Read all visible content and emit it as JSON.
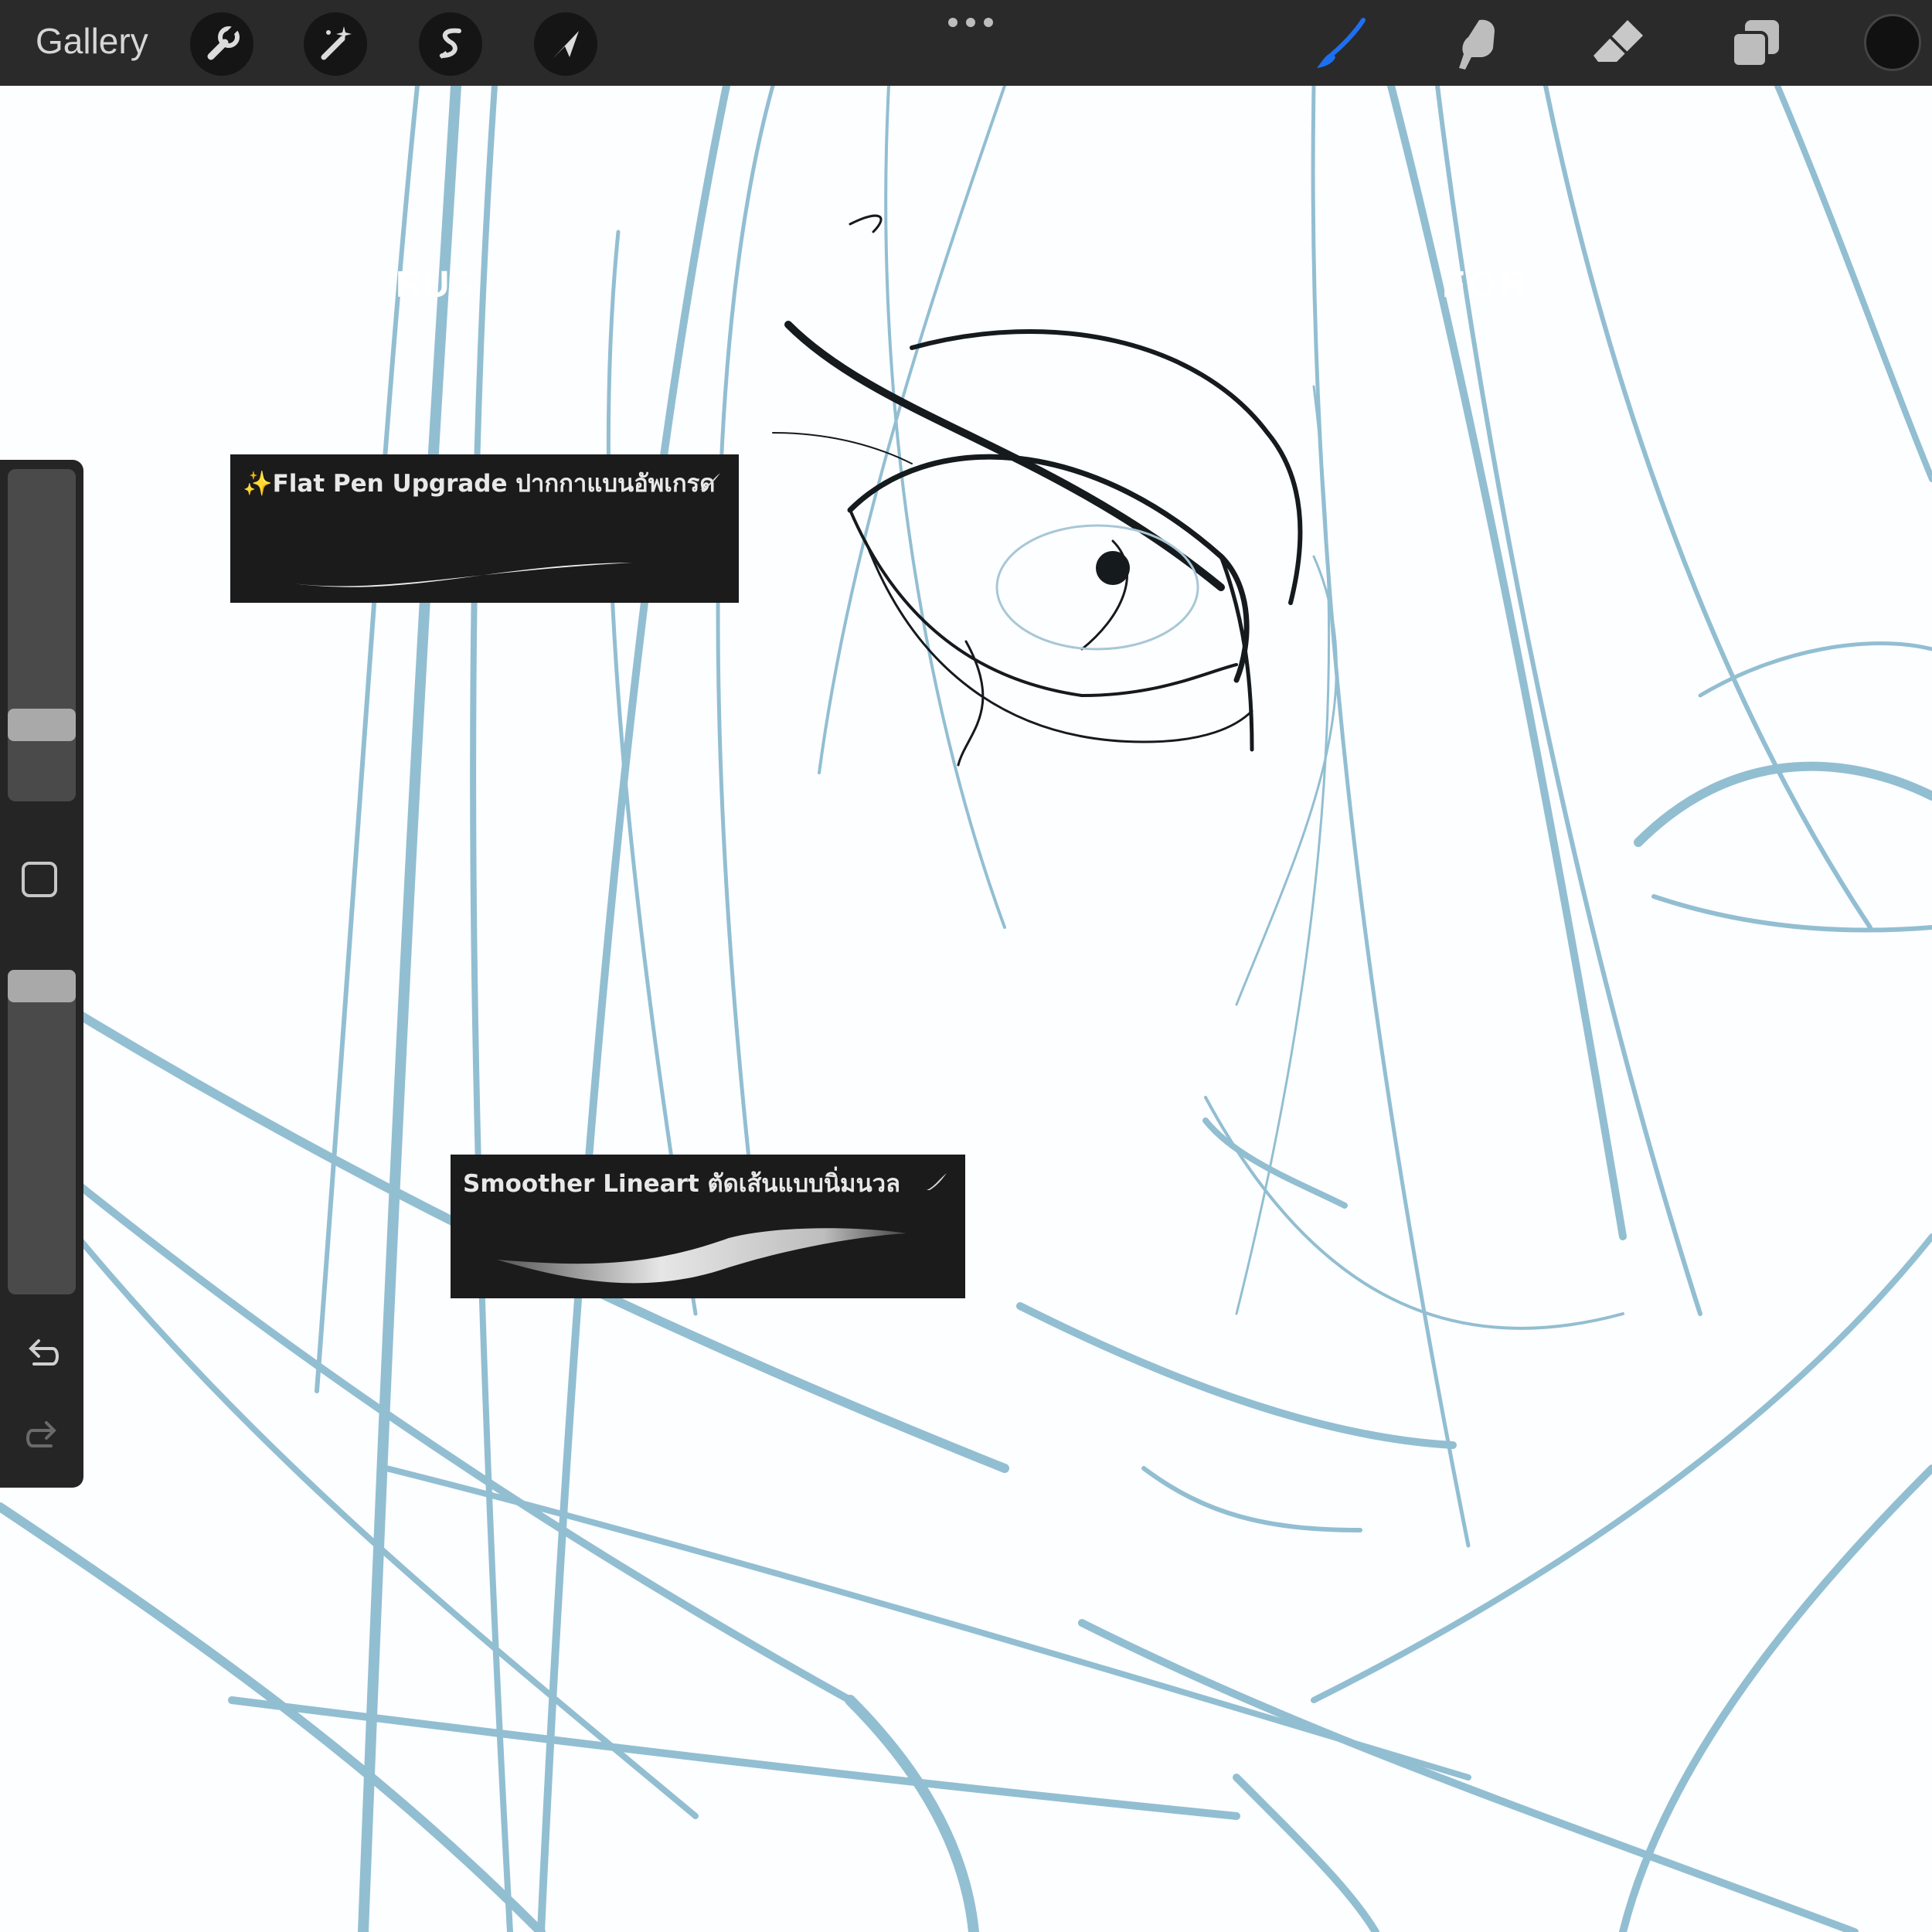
{
  "topbar": {
    "gallery_label": "Gallery",
    "tools_left": [
      "wrench-icon",
      "magic-wand-icon",
      "selection-icon",
      "transform-arrow-icon"
    ],
    "more_icon": "ellipsis-icon",
    "tools_right": [
      "brush-icon",
      "smudge-icon",
      "eraser-icon",
      "layers-icon"
    ],
    "active_tool": "brush",
    "active_tool_color": "#1e6ff0",
    "current_color": "#111111"
  },
  "brushes": {
    "flat_pen": {
      "label": "✨Flat Pen Upgrade ปากกาแบนอัพเกรด"
    },
    "smoother": {
      "label": "Smoother Lineart ตัดเส้นแบบนิ่มนวล"
    }
  },
  "sidebar": {
    "size_level": 0.2,
    "opacity_level": 1.0,
    "undo_icon": "undo-icon",
    "redo_icon": "redo-icon"
  },
  "overlay_text": {
    "left": "RUS",
    "right": "FOR"
  },
  "canvas": {
    "sketch_color": "#6fa9c4",
    "ink_color": "#151a1d"
  }
}
